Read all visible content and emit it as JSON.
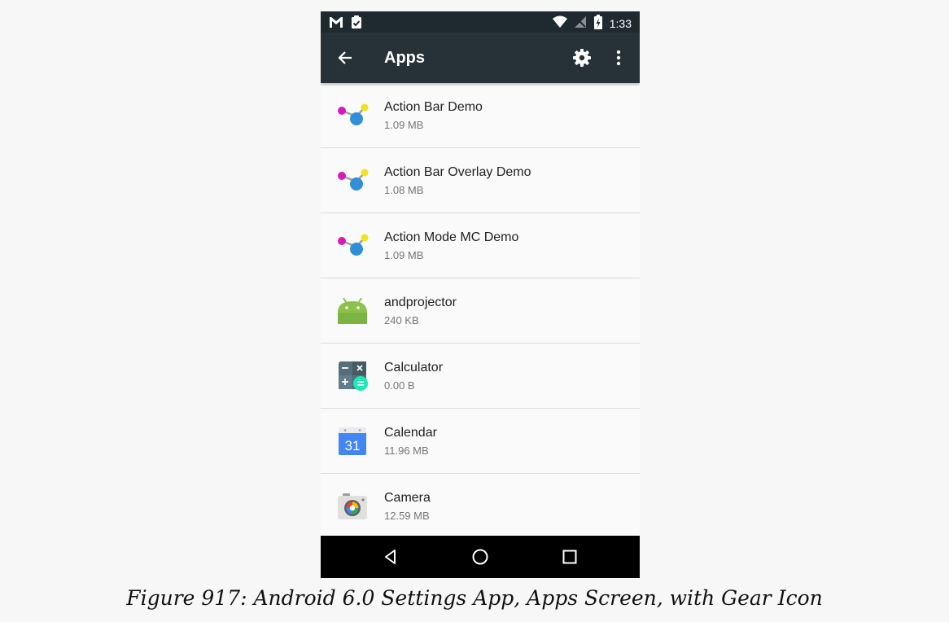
{
  "status_bar": {
    "time": "1:33",
    "icons": [
      "gmail-icon",
      "clipboard-check-icon",
      "wifi-icon",
      "no-signal-icon",
      "battery-charging-icon"
    ]
  },
  "app_bar": {
    "title": "Apps",
    "icons": [
      "back-arrow-icon",
      "gear-icon",
      "overflow-menu-icon"
    ]
  },
  "apps": [
    {
      "name": "Action Bar Demo",
      "size": "1.09 MB",
      "icon": "molecule-icon"
    },
    {
      "name": "Action Bar Overlay Demo",
      "size": "1.08 MB",
      "icon": "molecule-icon"
    },
    {
      "name": "Action Mode MC Demo",
      "size": "1.09 MB",
      "icon": "molecule-icon"
    },
    {
      "name": "andprojector",
      "size": "240 KB",
      "icon": "android-icon"
    },
    {
      "name": "Calculator",
      "size": "0.00 B",
      "icon": "calculator-icon"
    },
    {
      "name": "Calendar",
      "size": "11.96 MB",
      "icon": "calendar-icon",
      "icon_text": "31"
    },
    {
      "name": "Camera",
      "size": "12.59 MB",
      "icon": "camera-icon"
    }
  ],
  "nav_bar": {
    "icons": [
      "back-triangle-icon",
      "home-circle-icon",
      "recents-square-icon"
    ]
  },
  "caption": "Figure 917: Android 6.0 Settings App, Apps Screen, with Gear Icon",
  "colors": {
    "status_bar": "#1f2a30",
    "app_bar": "#263238",
    "list_background": "#fafafa",
    "divider": "#dcdcdc",
    "nav_bar": "#000000"
  }
}
